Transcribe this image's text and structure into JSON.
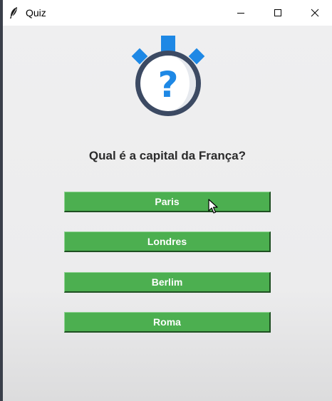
{
  "window": {
    "title": "Quiz",
    "controls": {
      "minimize_icon": "minimize-icon",
      "maximize_icon": "maximize-icon",
      "close_icon": "close-icon"
    }
  },
  "quiz": {
    "icon": "stopwatch-question-icon",
    "question": "Qual é a capital da França?",
    "answers": [
      "Paris",
      "Londres",
      "Berlim",
      "Roma"
    ]
  },
  "colors": {
    "button_green": "#4caf50",
    "icon_blue": "#1e88e5",
    "icon_ring": "#3c4a63",
    "background": "#f0f0f0"
  }
}
